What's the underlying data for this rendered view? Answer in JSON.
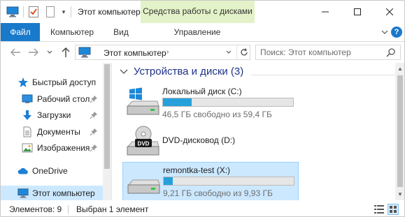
{
  "window": {
    "title": "Этот компьютер",
    "context_tab_title": "Средства работы с дисками"
  },
  "ribbon": {
    "tabs": [
      {
        "label": "Файл"
      },
      {
        "label": "Компьютер"
      },
      {
        "label": "Вид"
      },
      {
        "label": "Управление"
      }
    ]
  },
  "address_bar": {
    "path": "Этот компьютер",
    "search_placeholder": "Поиск: Этот компьютер"
  },
  "nav_pane": {
    "items": [
      {
        "label": "Быстрый доступ",
        "icon": "star-icon"
      },
      {
        "label": "Рабочий стол",
        "icon": "desktop-icon",
        "pinned": true
      },
      {
        "label": "Загрузки",
        "icon": "download-arrow-icon",
        "pinned": true
      },
      {
        "label": "Документы",
        "icon": "documents-icon",
        "pinned": true
      },
      {
        "label": "Изображения",
        "icon": "pictures-icon",
        "pinned": true
      },
      {
        "label": "OneDrive",
        "icon": "cloud-icon"
      },
      {
        "label": "Этот компьютер",
        "icon": "computer-icon",
        "selected": true
      }
    ]
  },
  "content": {
    "group_title": "Устройства и диски (3)",
    "drives": [
      {
        "name": "Локальный диск (C:)",
        "free_text": "46,5 ГБ свободно из 59,4 ГБ",
        "used_fraction": 0.22,
        "icon": "hard-disk-windows-icon"
      },
      {
        "name": "DVD-дисковод (D:)",
        "icon": "dvd-drive-icon"
      },
      {
        "name": "remontka-test (X:)",
        "free_text": "9,21 ГБ свободно из 9,93 ГБ",
        "used_fraction": 0.07,
        "icon": "removable-disk-icon",
        "selected": true
      }
    ]
  },
  "status_bar": {
    "item_count": "Элементов: 9",
    "selection": "Выбран 1 элемент"
  },
  "colors": {
    "accent": "#1979ca",
    "context_tab": "#e3f2c8",
    "selection_bg": "#cce8ff",
    "bar_fill": "#26a0da",
    "group_header": "#1e3287"
  }
}
